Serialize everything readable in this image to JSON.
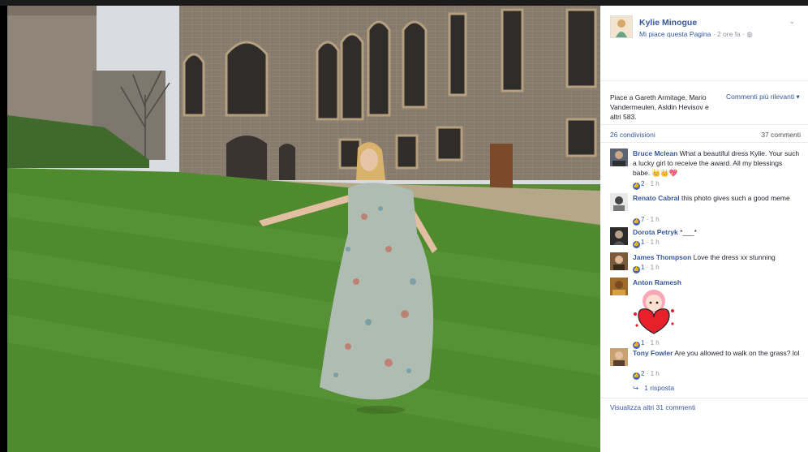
{
  "page": {
    "name": "Kylie Minogue",
    "like_page": "Mi piace questa Pagina",
    "time": "2 ore fa",
    "privacy_icon": "globe-icon",
    "menu_icon": "chevron-down-icon"
  },
  "likes_text": "Piace a Gareth Armitage, Mario Vandermeulen, Asldin Hevisov e altri 583.",
  "sort_label": "Commenti più rilevanti",
  "shares": "26 condivisioni",
  "comments_count": "37 commenti",
  "comments": [
    {
      "author": "Bruce Mclean",
      "text": "What a beautiful dress Kylie. Your such a lucky girl to receive the award. All my blessings babe. 👑👑💖",
      "likes": "2",
      "time": "1 h"
    },
    {
      "author": "Renato Cabral",
      "text": "this photo gives such a good meme",
      "likes": "7",
      "time": "1 h"
    },
    {
      "author": "Dorota Petryk",
      "text": "*___*",
      "likes": "1",
      "time": "1 h"
    },
    {
      "author": "James Thompson",
      "text": "Love the dress xx stunning",
      "likes": "1",
      "time": "1 h"
    },
    {
      "author": "Anton Ramesh",
      "text": "",
      "likes": "1",
      "time": "1 h",
      "sticker": "heart-hug-sticker"
    },
    {
      "author": "Tony Fowler",
      "text": "Are you allowed to walk on the grass? lol",
      "likes": "2",
      "time": "1 h"
    }
  ],
  "reply_link": "1 risposta",
  "more_comments": "Visualizza altri 31 commenti",
  "colors": {
    "link": "#365899",
    "like_blue": "#4267b2",
    "grass": "#4f8a2f",
    "stone": "#8a7d6c"
  }
}
